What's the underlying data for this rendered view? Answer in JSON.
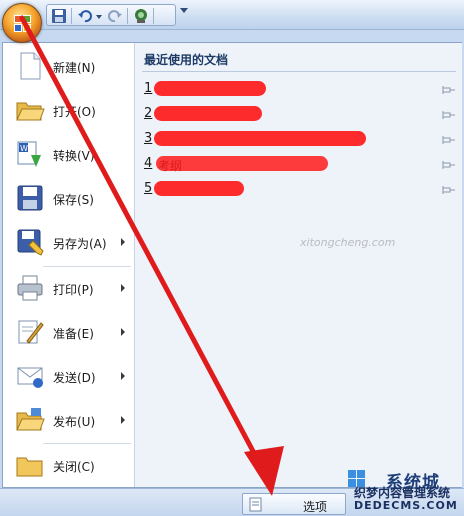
{
  "recent": {
    "title": "最近使用的文档",
    "items": [
      {
        "num": "1",
        "name": ""
      },
      {
        "num": "2",
        "name": ""
      },
      {
        "num": "3",
        "name": ""
      },
      {
        "num": "4",
        "name": "考纲"
      },
      {
        "num": "5",
        "name": ""
      }
    ]
  },
  "menu": {
    "items": [
      {
        "label": "新建(N)",
        "icon": "new-document-icon",
        "submenu": false
      },
      {
        "label": "打开(O)",
        "icon": "open-folder-icon",
        "submenu": false
      },
      {
        "label": "转换(V)",
        "icon": "convert-icon",
        "submenu": false
      },
      {
        "label": "保存(S)",
        "icon": "save-disk-icon",
        "submenu": false
      },
      {
        "label": "另存为(A)",
        "icon": "save-as-icon",
        "submenu": true
      },
      {
        "label": "打印(P)",
        "icon": "printer-icon",
        "submenu": true
      },
      {
        "label": "准备(E)",
        "icon": "prepare-icon",
        "submenu": true
      },
      {
        "label": "发送(D)",
        "icon": "send-icon",
        "submenu": true
      },
      {
        "label": "发布(U)",
        "icon": "publish-icon",
        "submenu": true
      },
      {
        "label": "关闭(C)",
        "icon": "close-folder-icon",
        "submenu": false
      }
    ]
  },
  "bottom": {
    "options_label": "选项"
  },
  "watermark": {
    "site": "xitongcheng.com",
    "logo_text": "系统城",
    "brand_line1": "织梦内容管理系统",
    "brand_line2": "DEDECMS.COM"
  },
  "colors": {
    "arrow": "#e01b1b",
    "redaction": "#ff1a1a",
    "accent": "#1d3b66"
  }
}
